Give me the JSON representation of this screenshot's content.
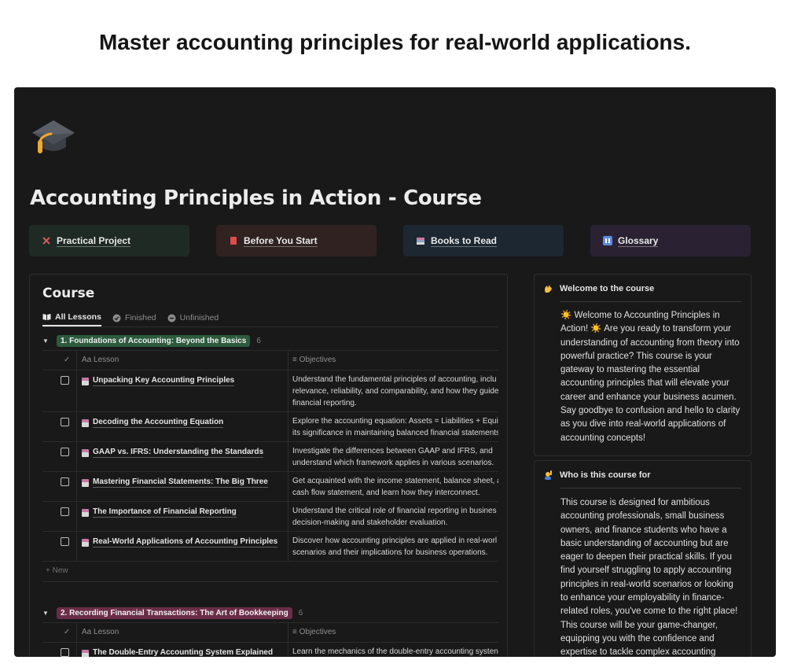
{
  "headline": "Master accounting principles for real-world applications.",
  "page": {
    "title": "Accounting Principles in Action - Course",
    "icon": "graduation-cap-icon"
  },
  "quick_links": [
    {
      "label": "Practical Project",
      "icon": "hammer-pick-icon",
      "bg": "#1f2a24",
      "icon_color": "#d05a5a"
    },
    {
      "label": "Before You Start",
      "icon": "red-book-icon",
      "bg": "#2f2220",
      "icon_color": "#e04a4a"
    },
    {
      "label": "Books to Read",
      "icon": "book-stack-icon",
      "bg": "#1d2731",
      "icon_color": "#8aa2c8"
    },
    {
      "label": "Glossary",
      "icon": "abcd-icon",
      "bg": "#2a2232",
      "icon_color": "#5c8de0"
    }
  ],
  "course": {
    "title": "Course",
    "tabs": [
      {
        "label": "All Lessons",
        "icon": "open-book-icon",
        "active": true
      },
      {
        "label": "Finished",
        "icon": "check-circle-icon",
        "active": false
      },
      {
        "label": "Unfinished",
        "icon": "minus-circle-icon",
        "active": false
      }
    ],
    "columns": {
      "lesson": "Lesson",
      "objectives": "Objectives",
      "lesson_prefix": "Aa"
    },
    "new_label": "New",
    "groups": [
      {
        "name": "1. Foundations of Accounting: Beyond the Basics",
        "count": "6",
        "color": "#2c5a3d",
        "lessons": [
          {
            "title": "Unpacking Key Accounting Principles",
            "objectives": [
              "Understand the fundamental principles of accounting, inclu",
              "relevance, reliability, and comparability, and how they guide",
              "financial reporting."
            ]
          },
          {
            "title": "Decoding the Accounting Equation",
            "objectives": [
              "Explore the accounting equation: Assets = Liabilities + Equit",
              "its significance in maintaining balanced financial statements"
            ]
          },
          {
            "title": "GAAP vs. IFRS: Understanding the Standards",
            "objectives": [
              "Investigate the differences between GAAP and IFRS, and",
              "understand which framework applies in various scenarios."
            ]
          },
          {
            "title": "Mastering Financial Statements: The Big Three",
            "objectives": [
              "Get acquainted with the income statement, balance sheet, a",
              "cash flow statement, and learn how they interconnect."
            ]
          },
          {
            "title": "The Importance of Financial Reporting",
            "objectives": [
              "Understand the critical role of financial reporting in busines",
              "decision-making and stakeholder evaluation."
            ]
          },
          {
            "title": "Real-World Applications of Accounting Principles",
            "objectives": [
              "Discover how accounting principles are applied in real-worl",
              "scenarios and their implications for business operations."
            ]
          }
        ]
      },
      {
        "name": "2. Recording Financial Transactions: The Art of Bookkeeping",
        "count": "6",
        "color": "#6a2d48",
        "lessons": [
          {
            "title": "The Double-Entry Accounting System Explained",
            "objectives": [
              "Learn the mechanics of the double-entry accounting systen"
            ]
          }
        ]
      }
    ]
  },
  "side": {
    "welcome": {
      "title": "Welcome to the course",
      "icon": "waving-hand-icon",
      "body": "☀️ Welcome to Accounting Principles in Action! ☀️ Are you ready to transform your understanding of accounting from theory into powerful practice? This course is your gateway to mastering the essential accounting principles that will elevate your career and enhance your business acumen. Say goodbye to confusion and hello to clarity as you dive into real-world applications of accounting concepts!"
    },
    "who": {
      "title": "Who is this course for",
      "icon": "person-raising-hand-icon",
      "body": "This course is designed for ambitious accounting professionals, small business owners, and finance students who have a basic understanding of accounting but are eager to deepen their practical skills. If you find yourself struggling to apply accounting principles in real-world scenarios or looking to enhance your employability in finance-related roles, you've come to the right place! This course will be your game-changer, equipping you with the confidence and expertise to tackle complex accounting"
    }
  }
}
